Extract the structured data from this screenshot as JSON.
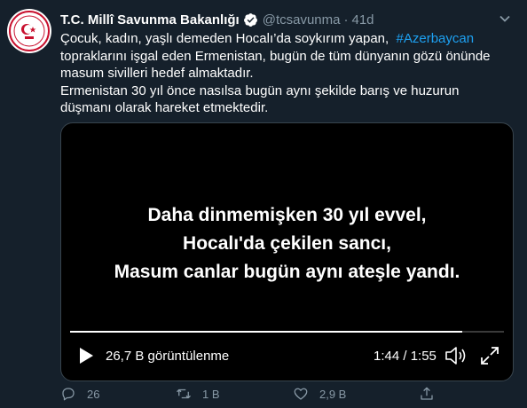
{
  "tweet": {
    "author_name": "T.C. Millî Savunma Bakanlığı",
    "handle": "@tcsavunma",
    "separator": "·",
    "time": "41d",
    "text_line1": "Çocuk, kadın, yaşlı demeden Hocalı’da soykırım yapan,",
    "hashtag": "#Azerbaycan",
    "text_line1_rest": "topraklarını işgal eden Ermenistan, bugün de tüm dünyanın gözü önünde masum sivilleri hedef almaktadır.",
    "text_paragraph2": "Ermenistan 30 yıl önce nasılsa bugün aynı şekilde barış ve huzurun düşmanı olarak hareket etmektedir."
  },
  "video": {
    "caption_lines": [
      "Daha dinmemişken 30 yıl evvel,",
      "Hocalı'da çekilen sancı,",
      "Masum canlar bugün aynı ateşle yandı."
    ],
    "views": "26,7 B görüntülenme",
    "time_display": "1:44 / 1:55",
    "progress": 0.904
  },
  "actions": {
    "reply_count": "26",
    "retweet_count": "1 B",
    "like_count": "2,9 B"
  },
  "colors": {
    "background": "#15202b",
    "secondary_text": "#8899a6",
    "accent": "#1da1f2",
    "media_bg": "#000000"
  },
  "icons": [
    "verified-icon",
    "chevron-down-icon",
    "play-icon",
    "volume-icon",
    "fullscreen-icon",
    "reply-icon",
    "retweet-icon",
    "like-icon",
    "share-icon"
  ]
}
